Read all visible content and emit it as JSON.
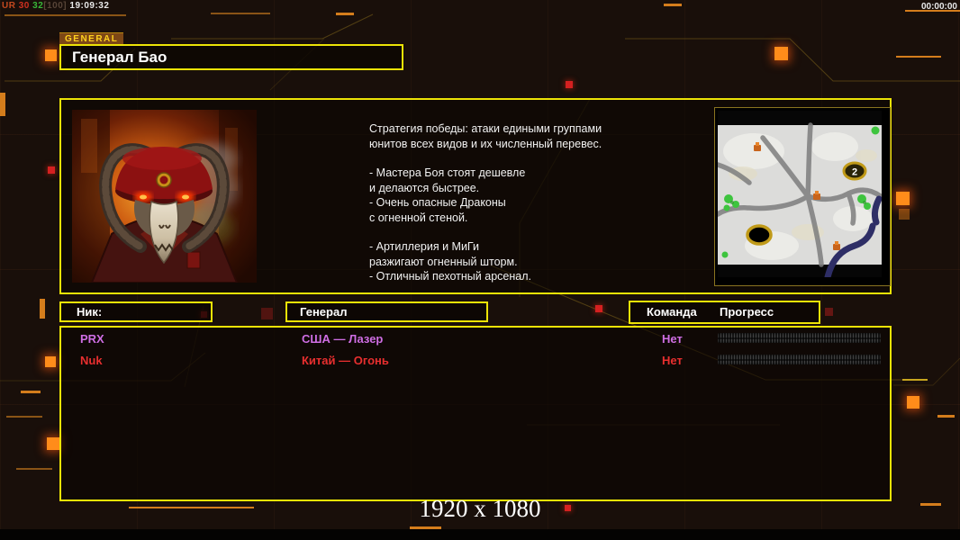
{
  "colors": {
    "accent_yellow": "#ece306",
    "accent_orange": "#e07818",
    "tab_bg": "#7d4716",
    "tab_text": "#ffd21e"
  },
  "debug_overlay": {
    "segments": [
      {
        "text": "UR ",
        "color": "#c4491f"
      },
      {
        "text": "30 ",
        "color": "#d03020"
      },
      {
        "text": "32",
        "color": "#38b838"
      },
      {
        "text": "[100] ",
        "color": "#574437"
      },
      {
        "text": "19:09:32",
        "color": "#e9e9e9"
      }
    ]
  },
  "match_timer": "00:00:00",
  "general_tab_label": "GENERAL",
  "general_title": "Генерал Бао",
  "strategy": {
    "paragraphs": [
      "Стратегия победы: атаки едиными группами\nюнитов всех видов и их численный перевес.",
      "- Мастера Боя стоят дешевле\nи делаются быстрее.\n- Очень опасные Драконы\nс огненной стеной.",
      "- Артиллерия и МиГи\nразжигают огненный шторм.\n- Отличный пехотный арсенал."
    ]
  },
  "minimap": {
    "start_position_label": "2"
  },
  "players_table": {
    "headers": {
      "nick": "Ник:",
      "general": "Генерал",
      "team": "Команда",
      "progress": "Прогресс"
    },
    "rows": [
      {
        "nick": "PRX",
        "general": "США — Лазер",
        "team": "Нет",
        "color": "#cf6ee4",
        "progress_percent": 0
      },
      {
        "nick": "Nuk",
        "general": "Китай — Огонь",
        "team": "Нет",
        "color": "#e82f2f",
        "progress_percent": 0
      }
    ]
  },
  "resolution_label": "1920 x 1080"
}
